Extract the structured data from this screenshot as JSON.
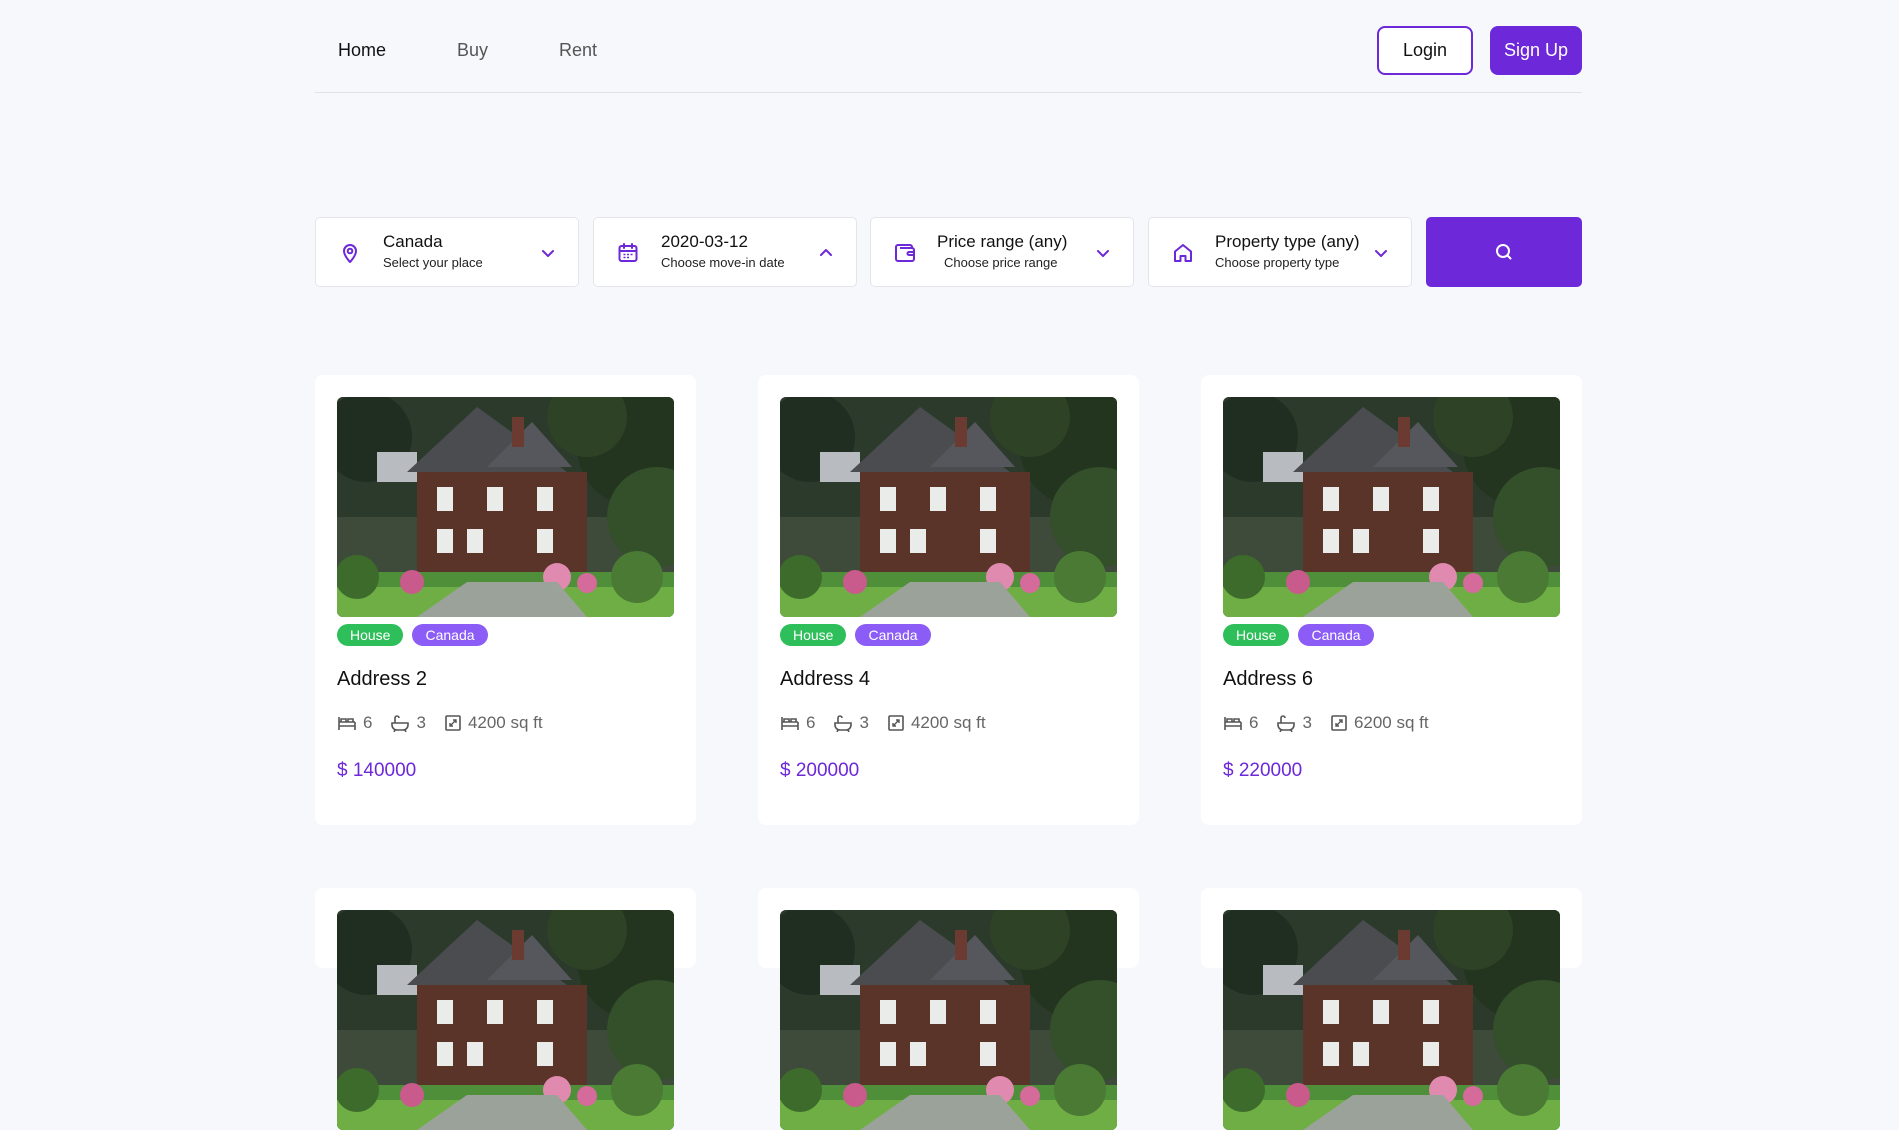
{
  "nav": {
    "links": [
      {
        "label": "Home",
        "active": true
      },
      {
        "label": "Buy",
        "active": false
      },
      {
        "label": "Rent",
        "active": false
      }
    ],
    "login_label": "Login",
    "signup_label": "Sign Up"
  },
  "filters": {
    "location": {
      "title": "Canada",
      "subtitle": "Select your place",
      "icon": "map-pin-icon"
    },
    "date": {
      "title": "2020-03-12",
      "subtitle": "Choose move-in date",
      "icon": "calendar-icon"
    },
    "price": {
      "title": "Price range (any)",
      "subtitle": "Choose price range",
      "icon": "wallet-icon"
    },
    "property": {
      "title": "Property type (any)",
      "subtitle": "Choose property type",
      "icon": "home-icon"
    },
    "search_icon": "search-icon"
  },
  "listings": [
    {
      "type": "House",
      "country": "Canada",
      "address": "Address 2",
      "beds": "6",
      "baths": "3",
      "area": "4200 sq ft",
      "price": "$ 140000"
    },
    {
      "type": "House",
      "country": "Canada",
      "address": "Address 4",
      "beds": "6",
      "baths": "3",
      "area": "4200 sq ft",
      "price": "$ 200000"
    },
    {
      "type": "House",
      "country": "Canada",
      "address": "Address 6",
      "beds": "6",
      "baths": "3",
      "area": "6200 sq ft",
      "price": "$ 220000"
    }
  ],
  "colors": {
    "accent": "#6d28d9",
    "tag_type": "#2fbf5a",
    "tag_country": "#8b5cf6",
    "background": "#f7f8fb"
  }
}
